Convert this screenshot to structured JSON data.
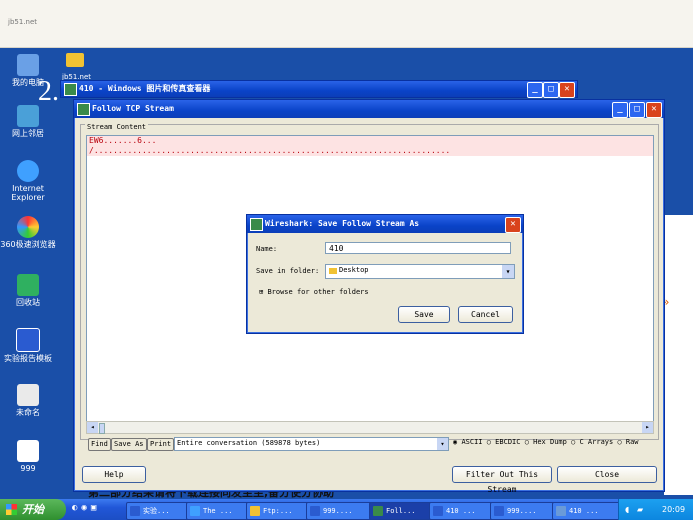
{
  "background_page": {
    "url_text": "jb51.net",
    "numeral": "2.",
    "partial_label": "jb51.net",
    "bottom_heading": "第二部分结果请将下载连接同发至至,备分使分协助"
  },
  "desktop": {
    "icons": [
      {
        "label": "我的电脑",
        "icon": "computer-icon"
      },
      {
        "label": "网上邻居",
        "icon": "network-icon"
      },
      {
        "label": "Internet Explorer",
        "icon": "ie-icon"
      },
      {
        "label": "360极速浏览器",
        "icon": "browser-icon"
      },
      {
        "label": "回收站",
        "icon": "recycle-bin-icon"
      },
      {
        "label": "实验报告模板",
        "icon": "word-doc-icon"
      },
      {
        "label": "未命名",
        "icon": "shortcut-icon"
      },
      {
        "label": "999",
        "icon": "document-icon"
      }
    ]
  },
  "viewer_window": {
    "title": "410 - Windows 图片和传真查看器"
  },
  "follow_window": {
    "title": "Follow TCP Stream",
    "group_label": "Stream Content",
    "stream_line1": "EW6.......6...",
    "stream_line2": "/..........................................................................",
    "buttons": {
      "find": "Find",
      "save_as": "Save As",
      "print": "Print"
    },
    "conversation_select": "Entire conversation (589878 bytes)",
    "radio_options": [
      "ASCII",
      "EBCDIC",
      "Hex Dump",
      "C Arrays",
      "Raw"
    ],
    "selected_radio": "ASCII",
    "help": "Help",
    "filter_out": "Filter Out This Stream",
    "close": "Close"
  },
  "save_dialog": {
    "title": "Wireshark: Save Follow Stream As",
    "name_label": "Name:",
    "name_value": "410",
    "folder_label": "Save in folder:",
    "folder_value": "Desktop",
    "browse_label": "Browse for other folders",
    "save": "Save",
    "cancel": "Cancel"
  },
  "taskbar": {
    "start": "开始",
    "items": [
      "实验...",
      "The ...",
      "Ftp:...",
      "999....",
      "Foll...",
      "410 ...",
      "999....",
      "410 ..."
    ],
    "clock": "20:09"
  },
  "colors": {
    "desktop_blue": "#1a4fa8",
    "xp_title_blue": "#0a43c8",
    "close_red": "#d9431c",
    "stream_red": "#b8000c"
  }
}
